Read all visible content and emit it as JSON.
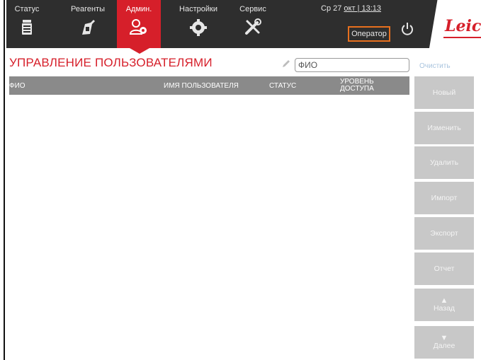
{
  "nav": {
    "items": [
      {
        "label": "Статус",
        "icon": "status-icon"
      },
      {
        "label": "Реагенты",
        "icon": "reagents-icon"
      },
      {
        "label": "Админ.",
        "icon": "admin-icon",
        "active": true
      },
      {
        "label": "Настройки",
        "icon": "settings-icon"
      },
      {
        "label": "Сервис",
        "icon": "service-icon"
      }
    ],
    "datetime_day": "Ср 27",
    "datetime_time": "окт | 13:13",
    "user_label": "Оператор",
    "power_icon": "power-icon",
    "logo_text": "Leica"
  },
  "page": {
    "title": "УПРАВЛЕНИЕ ПОЛЬЗОВАТЕЛЯМИ",
    "search_placeholder": "ФИО",
    "clear_label": "Очистить"
  },
  "table": {
    "columns": [
      "ФИО",
      "ИМЯ ПОЛЬЗОВАТЕЛЯ",
      "СТАТУС",
      "УРОВЕНЬ",
      "ДОСТУПА"
    ],
    "rows": []
  },
  "side_buttons": {
    "new": "Новый",
    "edit": "Изменить",
    "delete": "Удалить",
    "import": "Импорт",
    "export": "Экспорт",
    "report": "Отчет",
    "back": "Назад",
    "next": "Далее"
  },
  "colors": {
    "accent": "#d61f2a",
    "topbar": "#2e2e2e",
    "user_outline": "#e8701e",
    "button_disabled": "#c8c8c8",
    "table_header": "#8a8a8a"
  }
}
